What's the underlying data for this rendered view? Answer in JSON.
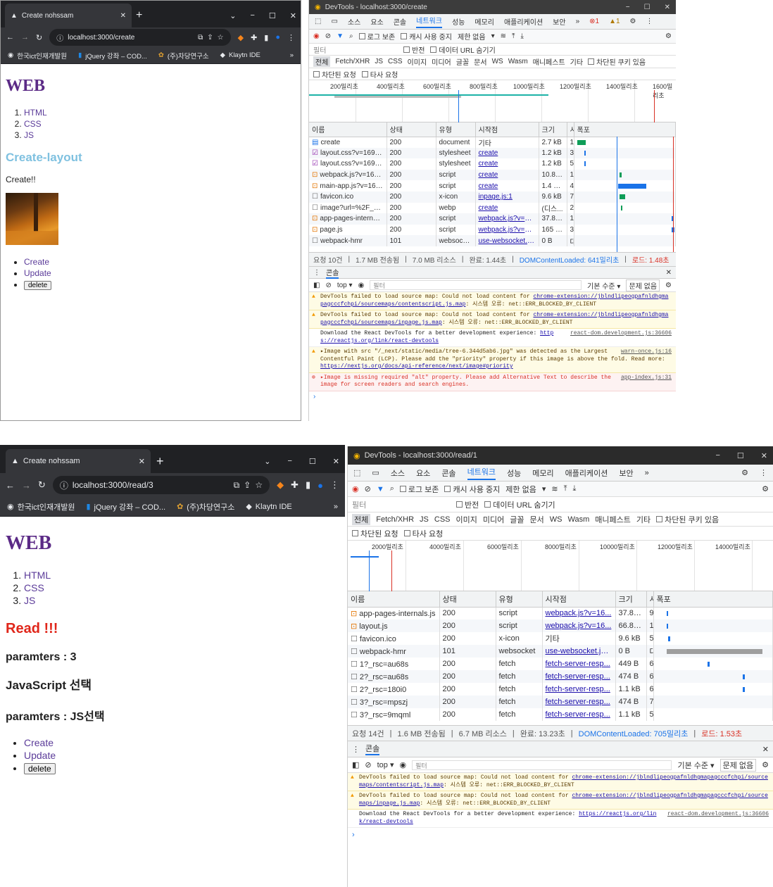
{
  "top": {
    "browser": {
      "tab_title": "Create nohssam",
      "url": "localhost:3000/create",
      "bookmarks": [
        "한국ict인재개발원",
        "jQuery 강좌 – COD...",
        "(주)차당연구소",
        "Klaytn IDE"
      ]
    },
    "page": {
      "heading": "WEB",
      "toc": [
        "HTML",
        "CSS",
        "JS"
      ],
      "subtitle": "Create-layout",
      "text": "Create!!",
      "links": [
        "Create",
        "Update"
      ],
      "delete_label": "delete"
    },
    "devtools": {
      "title": "DevTools - localhost:3000/create",
      "tabs": [
        "소스",
        "요소",
        "콘솔",
        "네트워크",
        "성능",
        "메모리",
        "애플리케이션",
        "보안"
      ],
      "active_tab": "네트워크",
      "err_count": "1",
      "warn_count": "1",
      "toolbar": {
        "preserve_log": "로그 보존",
        "disable_cache": "캐시 사용 중지",
        "throttle": "제한 없음"
      },
      "filter": {
        "placeholder": "필터",
        "invert": "반전",
        "hide_data": "데이터 URL 숨기기",
        "types": [
          "전체",
          "Fetch/XHR",
          "JS",
          "CSS",
          "이미지",
          "미디어",
          "글꼴",
          "문서",
          "WS",
          "Wasm",
          "매니페스트",
          "기타"
        ],
        "blocked_cookies": "차단된 쿠키 있음",
        "blocked_req": "차단된 요청",
        "third_party": "타사 요청"
      },
      "timeline_ticks": [
        "200밀리초",
        "400밀리초",
        "600밀리초",
        "800밀리초",
        "1000밀리초",
        "1200밀리초",
        "1400밀리초",
        "1600밀리초"
      ],
      "columns": [
        "이름",
        "상태",
        "유형",
        "시작점",
        "크기",
        "시",
        "폭포"
      ],
      "rows": [
        {
          "name": "create",
          "status": "200",
          "type": "document",
          "init": "기타",
          "size": "2.7 kB",
          "t": "1."
        },
        {
          "name": "layout.css?v=169335...",
          "status": "200",
          "type": "stylesheet",
          "init": "create",
          "size": "1.2 kB",
          "t": "3."
        },
        {
          "name": "layout.css?v=169335...",
          "status": "200",
          "type": "stylesheet",
          "init": "create",
          "size": "1.2 kB",
          "t": "5."
        },
        {
          "name": "webpack.js?v=16933...",
          "status": "200",
          "type": "script",
          "init": "create",
          "size": "10.8 kB",
          "t": "1."
        },
        {
          "name": "main-app.js?v=1693...",
          "status": "200",
          "type": "script",
          "init": "create",
          "size": "1.4 MB",
          "t": "4."
        },
        {
          "name": "favicon.ico",
          "status": "200",
          "type": "x-icon",
          "init": "inpage.js:1",
          "size": "9.6 kB",
          "t": "7."
        },
        {
          "name": "image?url=%2F_next...",
          "status": "200",
          "type": "webp",
          "init": "create",
          "size": "(디스...",
          "t": "2."
        },
        {
          "name": "app-pages-internals.js",
          "status": "200",
          "type": "script",
          "init": "webpack.js?v=16...",
          "size": "37.8 kB",
          "t": "1."
        },
        {
          "name": "page.js",
          "status": "200",
          "type": "script",
          "init": "webpack.js?v=16...",
          "size": "165 kB",
          "t": "3."
        },
        {
          "name": "webpack-hmr",
          "status": "101",
          "type": "websocket",
          "init": "use-websocket.js:...",
          "size": "0 B",
          "t": "대"
        }
      ],
      "summary": {
        "req": "요청 10건",
        "transferred": "1.7 MB 전송됨",
        "resources": "7.0 MB 리소스",
        "finish": "완료: 1.44초",
        "dcl": "DOMContentLoaded: 641밀리초",
        "load": "로드: 1.48초"
      },
      "console": {
        "title": "콘솔",
        "context": "top",
        "filter": "필터",
        "level": "기본 수준",
        "issues": "문제 없음",
        "messages": [
          {
            "kind": "warn",
            "text": "DevTools failed to load source map: Could not load content for ",
            "link": "chrome-extension://jblndlipeogpafnldhgmapagcccfchpi/sourcemaps/contentscript.js.map",
            "tail": ": 시스템 오류: net::ERR_BLOCKED_BY_CLIENT",
            "src": ""
          },
          {
            "kind": "warn",
            "text": "DevTools failed to load source map: Could not load content for ",
            "link": "chrome-extension://jblndlipeogpafnldhgmapagcccfchpi/sourcemaps/inpage.js.map",
            "tail": ": 시스템 오류: net::ERR_BLOCKED_BY_CLIENT",
            "src": ""
          },
          {
            "kind": "info",
            "text": "Download the React DevTools for a better development experience: ",
            "link": "https://reactjs.org/link/react-devtools",
            "tail": "",
            "src": "react-dom.development.js:36606"
          },
          {
            "kind": "warn",
            "text": "▸Image with src \"/_next/static/media/tree-6.344d5ab6.jpg\" was detected as the Largest Contentful Paint (LCP). Please add the \"priority\" property if this image is above the fold. Read more: ",
            "link": "https://nextjs.org/docs/api-reference/next/image#priority",
            "tail": "",
            "src": "warn-once.js:16"
          },
          {
            "kind": "err",
            "text": "▸Image is missing required \"alt\" property. Please add Alternative Text to describe the image for screen readers and search engines.",
            "link": "",
            "tail": "",
            "src": "app-index.js:31"
          }
        ]
      }
    }
  },
  "bottom": {
    "browser": {
      "tab_title": "Create nohssam",
      "url": "localhost:3000/read/3",
      "bookmarks": [
        "한국ict인재개발원",
        "jQuery 강좌 – COD...",
        "(주)차당연구소",
        "Klaytn IDE"
      ]
    },
    "page": {
      "heading": "WEB",
      "toc": [
        "HTML",
        "CSS",
        "JS"
      ],
      "read_title": "Read !!!",
      "param1": "paramters : 3",
      "select_text": "JavaScript 선택",
      "param2": "paramters : JS선택",
      "links": [
        "Create",
        "Update"
      ],
      "delete_label": "delete"
    },
    "devtools": {
      "title": "DevTools - localhost:3000/read/1",
      "tabs": [
        "소스",
        "요소",
        "콘솔",
        "네트워크",
        "성능",
        "메모리",
        "애플리케이션",
        "보안"
      ],
      "active_tab": "네트워크",
      "toolbar": {
        "preserve_log": "로그 보존",
        "disable_cache": "캐시 사용 중지",
        "throttle": "제한 없음"
      },
      "filter": {
        "placeholder": "필터",
        "invert": "반전",
        "hide_data": "데이터 URL 숨기기",
        "types": [
          "전체",
          "Fetch/XHR",
          "JS",
          "CSS",
          "이미지",
          "미디어",
          "글꼴",
          "문서",
          "WS",
          "Wasm",
          "매니페스트",
          "기타"
        ],
        "blocked_cookies": "차단된 쿠키 있음",
        "blocked_req": "차단된 요청",
        "third_party": "타사 요청"
      },
      "timeline_ticks": [
        "2000밀리초",
        "4000밀리초",
        "6000밀리초",
        "8000밀리초",
        "10000밀리초",
        "12000밀리초",
        "14000밀리초"
      ],
      "columns": [
        "이름",
        "상태",
        "유형",
        "시작점",
        "크기",
        "시",
        "폭포"
      ],
      "rows": [
        {
          "name": "app-pages-internals.js",
          "status": "200",
          "type": "script",
          "init": "webpack.js?v=16...",
          "size": "37.8 kB",
          "t": "9."
        },
        {
          "name": "layout.js",
          "status": "200",
          "type": "script",
          "init": "webpack.js?v=16...",
          "size": "66.8 kB",
          "t": "1."
        },
        {
          "name": "favicon.ico",
          "status": "200",
          "type": "x-icon",
          "init": "기타",
          "size": "9.6 kB",
          "t": "5."
        },
        {
          "name": "webpack-hmr",
          "status": "101",
          "type": "websocket",
          "init": "use-websocket.js:...",
          "size": "0 B",
          "t": "대"
        },
        {
          "name": "1?_rsc=au68s",
          "status": "200",
          "type": "fetch",
          "init": "fetch-server-resp...",
          "size": "449 B",
          "t": "6."
        },
        {
          "name": "2?_rsc=au68s",
          "status": "200",
          "type": "fetch",
          "init": "fetch-server-resp...",
          "size": "474 B",
          "t": "6."
        },
        {
          "name": "2?_rsc=180i0",
          "status": "200",
          "type": "fetch",
          "init": "fetch-server-resp...",
          "size": "1.1 kB",
          "t": "6."
        },
        {
          "name": "3?_rsc=mpszj",
          "status": "200",
          "type": "fetch",
          "init": "fetch-server-resp...",
          "size": "474 B",
          "t": "7."
        },
        {
          "name": "3?_rsc=9mqml",
          "status": "200",
          "type": "fetch",
          "init": "fetch-server-resp...",
          "size": "1.1 kB",
          "t": "5."
        }
      ],
      "summary": {
        "req": "요청 14건",
        "transferred": "1.6 MB 전송됨",
        "resources": "6.7 MB 리소스",
        "finish": "완료: 13.23초",
        "dcl": "DOMContentLoaded: 705밀리초",
        "load": "로드: 1.53초"
      },
      "console": {
        "title": "콘솔",
        "context": "top",
        "filter": "필터",
        "level": "기본 수준",
        "issues": "문제 없음",
        "messages": [
          {
            "kind": "warn",
            "text": "DevTools failed to load source map: Could not load content for ",
            "link": "chrome-extension://jblndlipeogpafnldhgmapagcccfchpi/sourcemaps/contentscript.js.map",
            "tail": ": 시스템 오류: net::ERR_BLOCKED_BY_CLIENT",
            "src": ""
          },
          {
            "kind": "warn",
            "text": "DevTools failed to load source map: Could not load content for ",
            "link": "chrome-extension://jblndlipeogpafnldhgmapagcccfchpi/sourcemaps/inpage.js.map",
            "tail": ": 시스템 오류: net::ERR_BLOCKED_BY_CLIENT",
            "src": ""
          },
          {
            "kind": "info",
            "text": "Download the React DevTools for a better development experience: ",
            "link": "https://reactjs.org/link/react-devtools",
            "tail": "",
            "src": "react-dom.development.js:36606"
          }
        ]
      }
    }
  },
  "colors": {
    "accent": "#1a73e8",
    "heading": "#5b2a86",
    "subtitle": "#7fc1e0",
    "read": "#e0261a",
    "error": "#d93025",
    "warn": "#f29900"
  }
}
